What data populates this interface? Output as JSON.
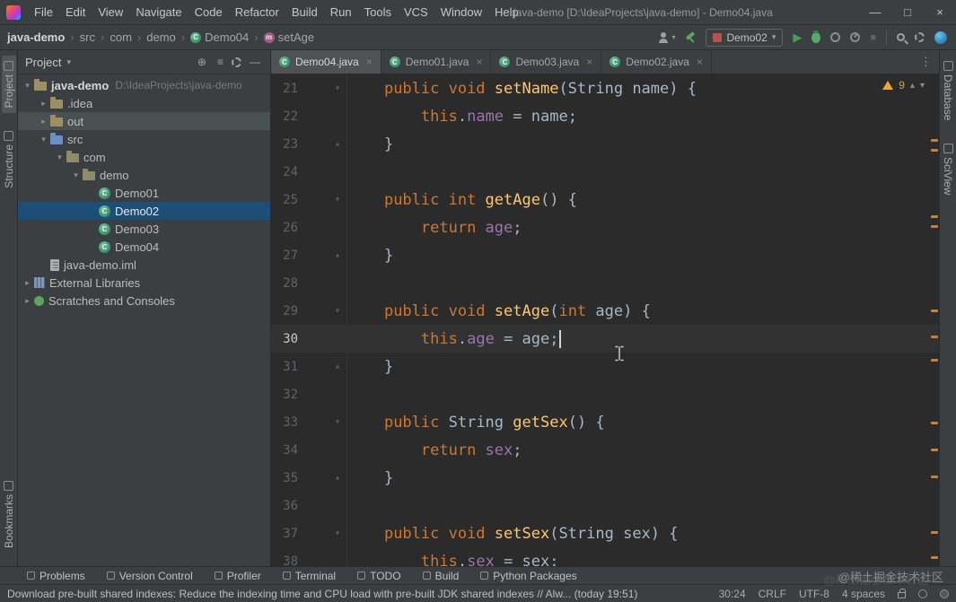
{
  "palette": {
    "keyword": "#cc7832",
    "method": "#ffc66d",
    "field": "#9876aa",
    "plain": "#a9b7c6",
    "editor_bg": "#2b2b2b",
    "panel_bg": "#3c3f41",
    "selection": "#1d4e77",
    "hover_row": "#4b5052",
    "current_line": "#323232",
    "accent_green": "#499c54",
    "change_mark": "#c4803c",
    "warning": "#f0a732"
  },
  "titlebar": {
    "menus": [
      "File",
      "Edit",
      "View",
      "Navigate",
      "Code",
      "Refactor",
      "Build",
      "Run",
      "Tools",
      "VCS",
      "Window",
      "Help"
    ],
    "title": "java-demo [D:\\IdeaProjects\\java-demo] - Demo04.java",
    "window_controls": {
      "minimize": "—",
      "maximize": "□",
      "close": "×"
    }
  },
  "navbar": {
    "breadcrumb": [
      {
        "label": "java-demo",
        "bold": true
      },
      {
        "label": "src"
      },
      {
        "label": "com"
      },
      {
        "label": "demo"
      },
      {
        "label": "Demo04",
        "icon": "class"
      },
      {
        "label": "setAge",
        "icon": "method"
      }
    ],
    "run_config": "Demo02"
  },
  "left_stripe": {
    "top": [
      "Project",
      "Structure"
    ],
    "bottom": [
      "Bookmarks"
    ]
  },
  "right_stripe": {
    "top": [
      "Database",
      "SciView"
    ]
  },
  "project_panel": {
    "header_label": "Project",
    "tree": [
      {
        "label": "java-demo",
        "hint": "D:\\IdeaProjects\\java-demo",
        "depth": 0,
        "icon": "folder",
        "chevron": "down",
        "bold": true
      },
      {
        "label": ".idea",
        "depth": 1,
        "icon": "folder",
        "chevron": "right"
      },
      {
        "label": "out",
        "depth": 1,
        "icon": "folder",
        "chevron": "right",
        "state": "hover"
      },
      {
        "label": "src",
        "depth": 1,
        "icon": "folder-src",
        "chevron": "down"
      },
      {
        "label": "com",
        "depth": 2,
        "icon": "package",
        "chevron": "down"
      },
      {
        "label": "demo",
        "depth": 3,
        "icon": "package",
        "chevron": "down"
      },
      {
        "label": "Demo01",
        "depth": 4,
        "icon": "class"
      },
      {
        "label": "Demo02",
        "depth": 4,
        "icon": "class",
        "state": "selected"
      },
      {
        "label": "Demo03",
        "depth": 4,
        "icon": "class"
      },
      {
        "label": "Demo04",
        "depth": 4,
        "icon": "class"
      },
      {
        "label": "java-demo.iml",
        "depth": 1,
        "icon": "file"
      },
      {
        "label": "External Libraries",
        "depth": 0,
        "icon": "library",
        "chevron": "right"
      },
      {
        "label": "Scratches and Consoles",
        "depth": 0,
        "icon": "scratch",
        "chevron": "right"
      }
    ]
  },
  "tabs": [
    {
      "label": "Demo04.java",
      "active": true
    },
    {
      "label": "Demo01.java"
    },
    {
      "label": "Demo03.java"
    },
    {
      "label": "Demo02.java"
    }
  ],
  "editor": {
    "inspection": {
      "count": "9"
    },
    "lines": [
      {
        "num": 21,
        "fold": "open",
        "segs": [
          [
            "pln",
            "    "
          ],
          [
            "kw",
            "public void "
          ],
          [
            "mth",
            "setName"
          ],
          [
            "pln",
            "(String name) {"
          ]
        ]
      },
      {
        "num": 22,
        "segs": [
          [
            "pln",
            "        "
          ],
          [
            "kw",
            "this"
          ],
          [
            "pln",
            "."
          ],
          [
            "fld",
            "name"
          ],
          [
            "pln",
            " = name;"
          ]
        ]
      },
      {
        "num": 23,
        "fold": "end",
        "segs": [
          [
            "pln",
            "    }"
          ]
        ]
      },
      {
        "num": 24,
        "segs": []
      },
      {
        "num": 25,
        "fold": "open",
        "segs": [
          [
            "pln",
            "    "
          ],
          [
            "kw",
            "public int "
          ],
          [
            "mth",
            "getAge"
          ],
          [
            "pln",
            "() {"
          ]
        ]
      },
      {
        "num": 26,
        "segs": [
          [
            "pln",
            "        "
          ],
          [
            "kw",
            "return "
          ],
          [
            "fld",
            "age"
          ],
          [
            "pln",
            ";"
          ]
        ]
      },
      {
        "num": 27,
        "fold": "end",
        "segs": [
          [
            "pln",
            "    }"
          ]
        ]
      },
      {
        "num": 28,
        "segs": []
      },
      {
        "num": 29,
        "fold": "open",
        "segs": [
          [
            "pln",
            "    "
          ],
          [
            "kw",
            "public void "
          ],
          [
            "mth",
            "setAge"
          ],
          [
            "pln",
            "("
          ],
          [
            "kw",
            "int"
          ],
          [
            "pln",
            " age) {"
          ]
        ]
      },
      {
        "num": 30,
        "current": true,
        "caret": true,
        "segs": [
          [
            "pln",
            "        "
          ],
          [
            "kw",
            "this"
          ],
          [
            "pln",
            "."
          ],
          [
            "fld",
            "age"
          ],
          [
            "pln",
            " = age;"
          ]
        ]
      },
      {
        "num": 31,
        "fold": "end",
        "segs": [
          [
            "pln",
            "    }"
          ]
        ]
      },
      {
        "num": 32,
        "segs": []
      },
      {
        "num": 33,
        "fold": "open",
        "segs": [
          [
            "pln",
            "    "
          ],
          [
            "kw",
            "public "
          ],
          [
            "pln",
            "String "
          ],
          [
            "mth",
            "getSex"
          ],
          [
            "pln",
            "() {"
          ]
        ]
      },
      {
        "num": 34,
        "segs": [
          [
            "pln",
            "        "
          ],
          [
            "kw",
            "return "
          ],
          [
            "fld",
            "sex"
          ],
          [
            "pln",
            ";"
          ]
        ]
      },
      {
        "num": 35,
        "fold": "end",
        "segs": [
          [
            "pln",
            "    }"
          ]
        ]
      },
      {
        "num": 36,
        "segs": []
      },
      {
        "num": 37,
        "fold": "open",
        "segs": [
          [
            "pln",
            "    "
          ],
          [
            "kw",
            "public void "
          ],
          [
            "mth",
            "setSex"
          ],
          [
            "pln",
            "(String sex) {"
          ]
        ]
      },
      {
        "num": 38,
        "segs": [
          [
            "pln",
            "        "
          ],
          [
            "kw",
            "this"
          ],
          [
            "pln",
            "."
          ],
          [
            "fld",
            "sex"
          ],
          [
            "pln",
            " = sex;"
          ]
        ]
      }
    ],
    "stripe_marks": [
      72,
      83,
      157,
      168,
      262,
      291,
      317,
      387,
      417,
      447,
      509,
      537
    ]
  },
  "bottom_bar": {
    "items": [
      {
        "icon": "problems-icon",
        "label": "Problems"
      },
      {
        "icon": "version-control-icon",
        "label": "Version Control"
      },
      {
        "icon": "profiler-icon",
        "label": "Profiler"
      },
      {
        "icon": "terminal-icon",
        "label": "Terminal"
      },
      {
        "icon": "todo-icon",
        "label": "TODO"
      },
      {
        "icon": "build-icon",
        "label": "Build"
      },
      {
        "icon": "python-packages-icon",
        "label": "Python Packages"
      }
    ],
    "watermark": "@稀土掘金技术社区"
  },
  "status_bar": {
    "message": "Download pre-built shared indexes: Reduce the indexing time and CPU load with pre-built JDK shared indexes // Alw... (today 19:51)",
    "items": [
      "30:24",
      "CRLF",
      "UTF-8",
      "4 spaces"
    ]
  }
}
